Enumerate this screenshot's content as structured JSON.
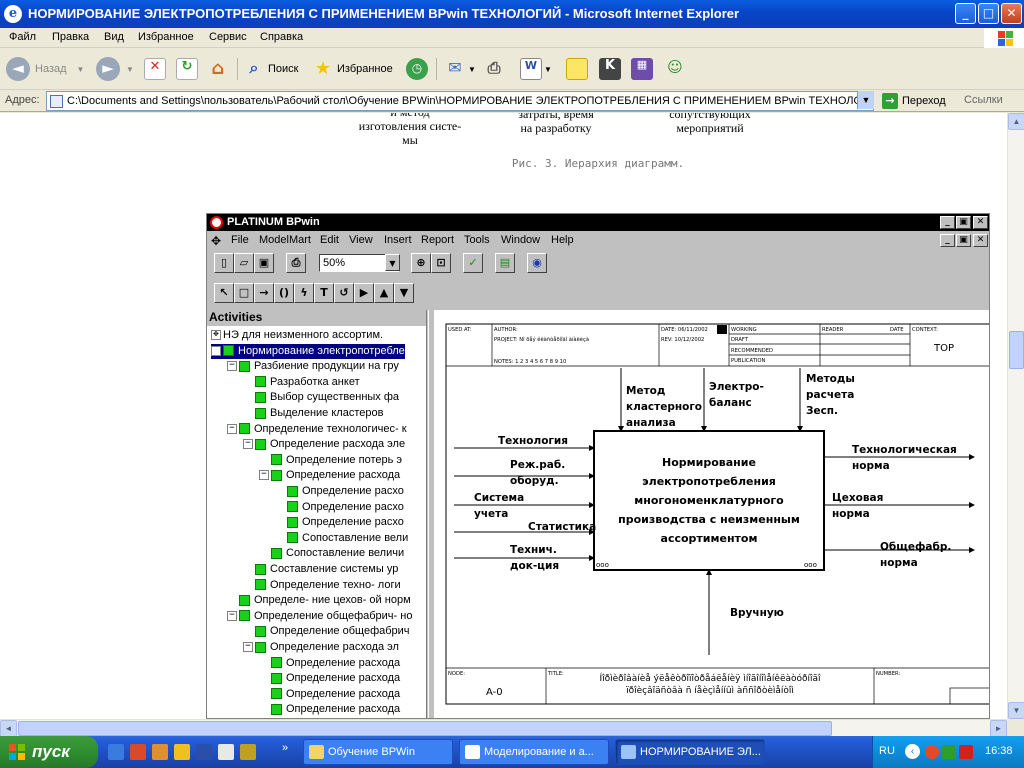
{
  "window": {
    "title": "НОРМИРОВАНИЕ ЭЛЕКТРОПОТРЕБЛЕНИЯ С ПРИМЕНЕНИЕМ BPwin ТЕХНОЛОГИЙ - Microsoft Internet Explorer",
    "buttons": {
      "minimize": "_",
      "maximize": "□",
      "close": "✕"
    }
  },
  "menu": [
    "Файл",
    "Правка",
    "Вид",
    "Избранное",
    "Сервис",
    "Справка"
  ],
  "toolbar": {
    "back": "Назад",
    "search": "Поиск",
    "favorites": "Избранное"
  },
  "address": {
    "label": "Адрес:",
    "url": "C:\\Documents and Settings\\пользователь\\Рабочий стол\\Обучение BPWin\\НОРМИРОВАНИЕ ЭЛЕКТРОПОТРЕБЛЕНИЯ С ПРИМЕНЕНИЕМ BPwin ТЕХНОЛОГИЙ.htm",
    "go": "Переход",
    "links": "Ссылки"
  },
  "page": {
    "node1": "и метод\nизготовления систе-\nмы",
    "node2": "затраты, время\nна разработку",
    "node3": "сопутствующих\nмероприятий",
    "caption": "Рис. 3. Иерархия диаграмм."
  },
  "bpwin": {
    "title": "PLATINUM BPwin",
    "menu": [
      "File",
      "ModelMart",
      "Edit",
      "View",
      "Insert",
      "Report",
      "Tools",
      "Window",
      "Help"
    ],
    "zoom": "50%",
    "tree_header": "Activities",
    "tree": [
      {
        "label": "НЭ для неизменного ассортим.",
        "level": 0,
        "toggle": "",
        "selected": false,
        "icon": "root"
      },
      {
        "label": "Нормирование электропотребле",
        "level": 0,
        "toggle": "-",
        "selected": true,
        "icon": "green"
      },
      {
        "label": "Разбиение продукции на гру",
        "level": 1,
        "toggle": "-",
        "selected": false,
        "icon": "green"
      },
      {
        "label": "Разработка анкет",
        "level": 2,
        "toggle": "",
        "selected": false,
        "icon": "green"
      },
      {
        "label": "Выбор существенных фа",
        "level": 2,
        "toggle": "",
        "selected": false,
        "icon": "green"
      },
      {
        "label": "Выделение кластеров",
        "level": 2,
        "toggle": "",
        "selected": false,
        "icon": "green"
      },
      {
        "label": "Определение технологичес- к",
        "level": 1,
        "toggle": "-",
        "selected": false,
        "icon": "green"
      },
      {
        "label": "Определение расхода эле",
        "level": 2,
        "toggle": "-",
        "selected": false,
        "icon": "green"
      },
      {
        "label": "Определение потерь э",
        "level": 3,
        "toggle": "",
        "selected": false,
        "icon": "green"
      },
      {
        "label": "Определение расхода",
        "level": 3,
        "toggle": "-",
        "selected": false,
        "icon": "green"
      },
      {
        "label": "Определение расхо",
        "level": 4,
        "toggle": "",
        "selected": false,
        "icon": "green"
      },
      {
        "label": "Определение расхо",
        "level": 4,
        "toggle": "",
        "selected": false,
        "icon": "green"
      },
      {
        "label": "Определение расхо",
        "level": 4,
        "toggle": "",
        "selected": false,
        "icon": "green"
      },
      {
        "label": "Сопоставление вели",
        "level": 4,
        "toggle": "",
        "selected": false,
        "icon": "green"
      },
      {
        "label": "Сопоставление величи",
        "level": 3,
        "toggle": "",
        "selected": false,
        "icon": "green"
      },
      {
        "label": "Составление системы ур",
        "level": 2,
        "toggle": "",
        "selected": false,
        "icon": "green"
      },
      {
        "label": "Определение техно- логи",
        "level": 2,
        "toggle": "",
        "selected": false,
        "icon": "green"
      },
      {
        "label": "Определе- ние цехов- ой норм",
        "level": 1,
        "toggle": "",
        "selected": false,
        "icon": "green"
      },
      {
        "label": "Определение общефабрич- но",
        "level": 1,
        "toggle": "-",
        "selected": false,
        "icon": "green"
      },
      {
        "label": "Определение общефабрич",
        "level": 2,
        "toggle": "",
        "selected": false,
        "icon": "green"
      },
      {
        "label": "Определение расхода эл",
        "level": 2,
        "toggle": "-",
        "selected": false,
        "icon": "green"
      },
      {
        "label": "Определение расхода",
        "level": 3,
        "toggle": "",
        "selected": false,
        "icon": "green"
      },
      {
        "label": "Определение расхода",
        "level": 3,
        "toggle": "",
        "selected": false,
        "icon": "green"
      },
      {
        "label": "Определение расхода",
        "level": 3,
        "toggle": "",
        "selected": false,
        "icon": "green"
      },
      {
        "label": "Определение расхода",
        "level": 3,
        "toggle": "",
        "selected": false,
        "icon": "green"
      }
    ],
    "frame": {
      "used_at": "USED AT:",
      "author": "AUTHOR:",
      "project": "PROJECT:  Nî ðåý êëàñòåðíîãî àíàëèçà",
      "notes": "NOTES:  1  2  3  4  5  6  7  8  9  10",
      "date": "DATE: 06/11/2002",
      "rev": "REV:   10/12/2002",
      "working": "WORKING",
      "draft": "DRAFT",
      "recommended": "RECOMMENDED",
      "publication": "PUBLICATION",
      "reader": "READER",
      "date2": "DATE",
      "context": "CONTEXT:",
      "top": "TOP",
      "node_label": "NODE:",
      "node_value": "A-0",
      "title_label": "TITLE:",
      "title_value1": "Íîðìèðîâàíèå ýëåêòðîïîòðåáëåíèÿ ìíîãîíîìåíêëàòóðíîãî",
      "title_value2": "ïðîèçâîäñòâà ñ íåèçìåííûì àññîðòèìåíòîì",
      "number_label": "NUMBER:"
    },
    "activity": "Нормирование\nэлектропотребления\nмногономенклатурного\nпроизводства с неизменным\nассортиментом",
    "controls": [
      "Метод\nкластерного\nанализа",
      "Электро-\nбаланс",
      "Методы\nрасчета\nЗесп."
    ],
    "inputs": [
      "Технология",
      "Реж.раб.\nоборуд.",
      "Система\nучета",
      "Статистика",
      "Технич.\nдок-ция"
    ],
    "outputs": [
      "Технологическая\nнорма",
      "Цеховая\nнорма",
      "Общефабр.\nнорма"
    ],
    "mechanism": "Вручную"
  },
  "taskbar": {
    "start": "пуск",
    "tasks": [
      "Обучение BPWin",
      "Моделирование и а...",
      "НОРМИРОВАНИЕ ЭЛ..."
    ],
    "lang": "RU",
    "clock": "16:38"
  }
}
